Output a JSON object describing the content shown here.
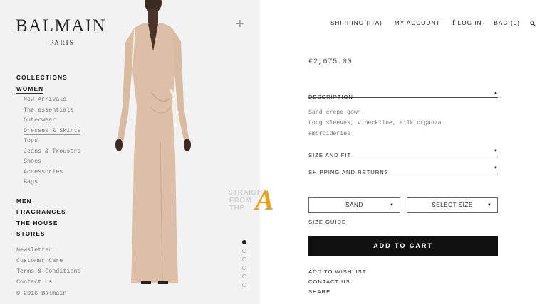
{
  "brand": {
    "name": "BALMAIN",
    "city": "PARIS"
  },
  "header": {
    "plus_label": "+",
    "shipping": "SHIPPING (ITA)",
    "account": "MY ACCOUNT",
    "login_icon": "f",
    "login": "LOG IN",
    "bag": "BAG (0)",
    "search_icon": "search-icon"
  },
  "nav": {
    "collections": "COLLECTIONS",
    "women": "WOMEN",
    "women_sub": [
      "New Arrivals",
      "The essentials",
      "Outerwear",
      "Dresses & Skirts",
      "Tops",
      "Jeans & Trousers",
      "Shoes",
      "Accessories",
      "Bags"
    ],
    "men": "MEN",
    "fragrances": "FRAGRANCES",
    "the_house": "THE HOUSE",
    "stores": "STORES",
    "footer": [
      "Newsletter",
      "Customer Care",
      "Terms & Conditions",
      "Contact Us",
      "© 2016 Balmain"
    ]
  },
  "product": {
    "price": "€2,675.00",
    "description_label": "DESCRIPTION",
    "description_caret": "▲",
    "description_lines": [
      "Sand crepe gown",
      "Long sleeves, V neckline, silk organza",
      "embroideries"
    ],
    "size_fit_label": "SIZE AND FIT",
    "shipping_returns_label": "SHIPPING AND RETURNS",
    "collapsed_caret": "▼",
    "color_value": "SAND",
    "size_value": "SELECT SIZE",
    "size_guide": "SIZE GUIDE",
    "add_to_cart": "ADD TO CART",
    "wishlist": "ADD TO WISHLIST",
    "contact": "CONTACT US",
    "share": "SHARE"
  },
  "carousel": {
    "count": 6,
    "active": 0
  },
  "watermark": {
    "line1": "STRAIGHT",
    "line2": "FROM",
    "line3": "THE",
    "letter": "A"
  },
  "colors": {
    "accent": "#111111",
    "panel": "#f2f2f2",
    "dress": "#dcbfa6",
    "watermark_gold": "#e8a21c"
  }
}
